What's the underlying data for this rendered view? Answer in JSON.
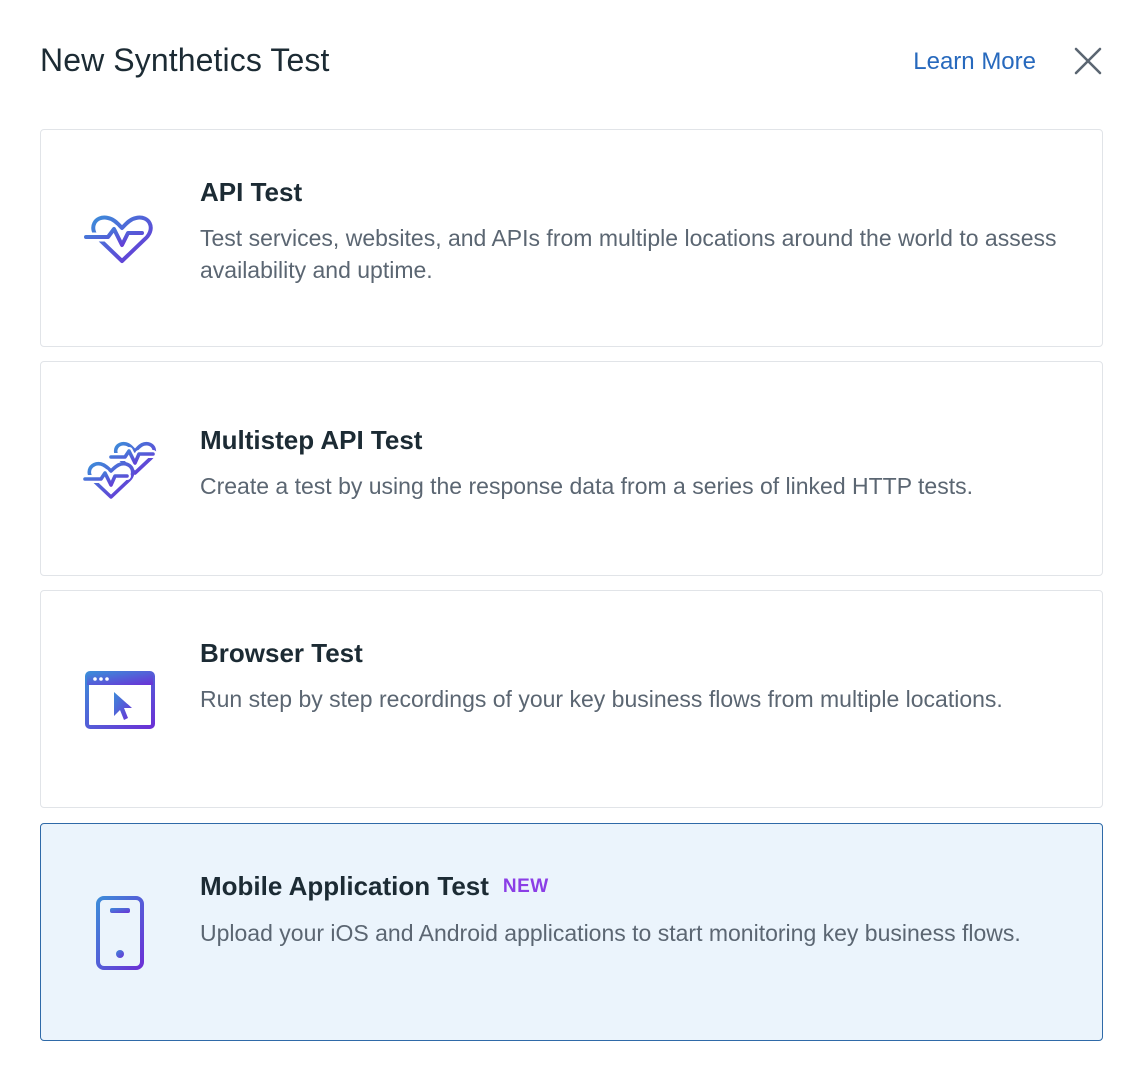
{
  "header": {
    "title": "New Synthetics Test",
    "learn_more": "Learn More"
  },
  "colors": {
    "accent": "#2769bd",
    "icon_gradient_start": "#3d8bd9",
    "icon_gradient_end": "#6b30d6",
    "selected_bg": "#ebf4fc",
    "selected_border": "#2f6aa8",
    "new_badge": "#8b3ee6"
  },
  "cards": [
    {
      "title": "API Test",
      "description": "Test services, websites, and APIs from multiple locations around the world to assess availability and uptime.",
      "icon": "heartbeat-icon"
    },
    {
      "title": "Multistep API Test",
      "description": "Create a test by using the response data from a series of linked HTTP tests.",
      "icon": "double-heartbeat-icon"
    },
    {
      "title": "Browser Test",
      "description": "Run step by step recordings of your key business flows from multiple locations.",
      "icon": "browser-window-cursor-icon"
    },
    {
      "title": "Mobile Application Test",
      "badge": "NEW",
      "description": "Upload your iOS and Android applications to start monitoring key business flows.",
      "icon": "mobile-phone-icon",
      "selected": true
    }
  ]
}
